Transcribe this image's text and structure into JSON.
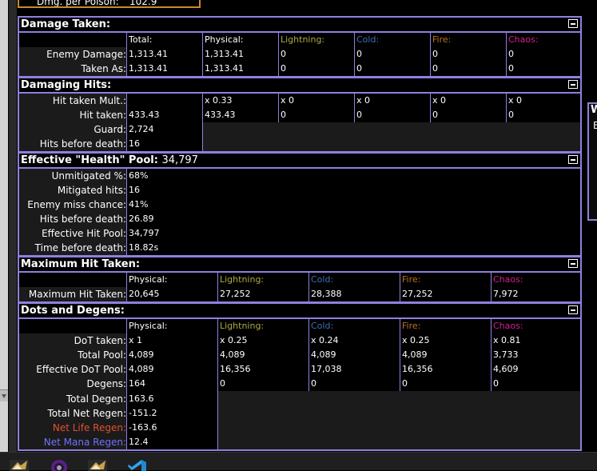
{
  "poison": {
    "label": "Dmg. per Poison:",
    "value": "102.9"
  },
  "right_panel": {
    "title": "W",
    "text": "E"
  },
  "sections": {
    "damage_taken": {
      "title": "Damage Taken:",
      "headers": [
        "Total:",
        "Physical:",
        "Lightning:",
        "Cold:",
        "Fire:",
        "Chaos:"
      ],
      "rows": [
        {
          "label": "Enemy Damage:",
          "values": [
            "1,313.41",
            "1,313.41",
            "0",
            "0",
            "0",
            "0"
          ]
        },
        {
          "label": "Taken As:",
          "values": [
            "1,313.41",
            "1,313.41",
            "0",
            "0",
            "0",
            "0"
          ]
        }
      ]
    },
    "damaging_hits": {
      "title": "Damaging Hits:",
      "rows": [
        {
          "label": "Hit taken Mult.:",
          "values": [
            "",
            "x 0.33",
            "x 0",
            "x 0",
            "x 0",
            "x 0"
          ]
        },
        {
          "label": "Hit taken:",
          "values": [
            "433.43",
            "433.43",
            "0",
            "0",
            "0",
            "0"
          ]
        },
        {
          "label": "Guard:",
          "values": [
            "2,724"
          ]
        },
        {
          "label": "Hits before death:",
          "values": [
            "16"
          ]
        }
      ]
    },
    "ehp": {
      "title": "Effective \"Health\" Pool:",
      "title_value": "34,797",
      "rows": [
        {
          "label": "Unmitigated %:",
          "value": "68%"
        },
        {
          "label": "Mitigated hits:",
          "value": "16"
        },
        {
          "label": "Enemy miss chance:",
          "value": "41%"
        },
        {
          "label": "Hits before death:",
          "value": "26.89"
        },
        {
          "label": "Effective Hit Pool:",
          "value": "34,797"
        },
        {
          "label": "Time before death:",
          "value": "18.82s"
        }
      ]
    },
    "max_hit": {
      "title": "Maximum Hit Taken:",
      "headers": [
        "Physical:",
        "Lightning:",
        "Cold:",
        "Fire:",
        "Chaos:"
      ],
      "row": {
        "label": "Maximum Hit Taken:",
        "values": [
          "20,645",
          "27,252",
          "28,388",
          "27,252",
          "7,972"
        ]
      }
    },
    "dots": {
      "title": "Dots and Degens:",
      "headers": [
        "Physical:",
        "Lightning:",
        "Cold:",
        "Fire:",
        "Chaos:"
      ],
      "rows": [
        {
          "label": "DoT taken:",
          "values": [
            "x 1",
            "x 0.25",
            "x 0.24",
            "x 0.25",
            "x 0.81"
          ]
        },
        {
          "label": "Total Pool:",
          "values": [
            "4,089",
            "4,089",
            "4,089",
            "4,089",
            "3,733"
          ]
        },
        {
          "label": "Effective DoT Pool:",
          "values": [
            "4,089",
            "16,356",
            "17,038",
            "16,356",
            "4,609"
          ]
        },
        {
          "label": "Degens:",
          "values": [
            "164",
            "0",
            "0",
            "0",
            "0"
          ]
        }
      ],
      "single_rows": [
        {
          "label": "Total Degen:",
          "value": "163.6"
        },
        {
          "label": "Total Net Regen:",
          "value": "-151.2"
        },
        {
          "label": "Net Life Regen:",
          "value": "-163.6"
        },
        {
          "label": "Net Mana Regen:",
          "value": "12.4"
        }
      ]
    }
  },
  "colors": {
    "border": "#8f7fdf",
    "physical": "#ffffff",
    "lightning": "#adaa47",
    "cold": "#3f6db3",
    "fire": "#b97123",
    "chaos": "#d02090",
    "life": "#e05030",
    "mana": "#7070ff",
    "label": "#ffffff"
  },
  "taskbar": {
    "icons": [
      "game-icon",
      "obs-icon",
      "game-icon-2",
      "vscode-icon"
    ]
  }
}
